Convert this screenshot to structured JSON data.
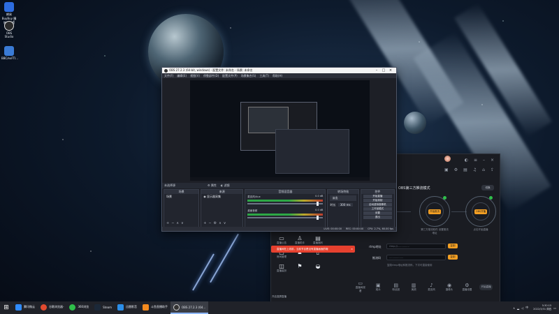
{
  "desktop": {
    "icons": [
      {
        "label": "網易BuyBuy\n購物與電商",
        "icon": "app-icon",
        "color": "#2d6cdf"
      },
      {
        "label": "OBS Studio",
        "icon": "obs-icon",
        "color": "#2b2b2b"
      },
      {
        "label": "BBC/exFTI...",
        "icon": "shortcut-icon",
        "color": "#3a7bd5"
      }
    ]
  },
  "obs": {
    "title": "OBS 27.2.3 (64-bit, windows) - 配置文件: 未命名 - 场景: 未命名",
    "menu": [
      "文件(F)",
      "编辑(E)",
      "视图(V)",
      "停靠部件(D)",
      "配置文件(P)",
      "场景集合(S)",
      "工具(T)",
      "帮助(H)"
    ],
    "controls": [
      "未选择源",
      "属性",
      "滤镜"
    ],
    "docks": {
      "scenes_title": "场景",
      "scenes": [
        "场景"
      ],
      "sources_title": "来源",
      "sources": [
        "显示器采集"
      ],
      "mixer_title": "音频混音器",
      "mixer": [
        {
          "label": "麦克风/Aux",
          "value": "0.0 dB"
        },
        {
          "label": "桌面音频",
          "value": "0.0 dB"
        }
      ],
      "transitions_title": "转场特效",
      "transition": "淡出",
      "duration_label": "时长",
      "duration": "300 ms",
      "controls_title": "控件",
      "control_buttons": [
        "开始直播",
        "开始录制",
        "启动虚拟摄像机",
        "工作室模式",
        "设置",
        "退出"
      ]
    },
    "status": [
      "LIVE: 00:00:00",
      "REC: 00:00:00",
      "CPU: 2.7%, 60.00 fps"
    ]
  },
  "companion": {
    "mode_title": "OBS第三方推流模式",
    "mode_switch": "切换",
    "steps": [
      {
        "tag": "开始推流",
        "caption": "第三方推流软件\n设置推流地址"
      },
      {
        "tag": "OBS开播",
        "caption": "点击开始直播"
      }
    ],
    "rtmp_label": "rtmp地址",
    "rtmp_value": "rtmp://...............",
    "key_label": "推流码",
    "key_value": "..................",
    "copy": "复制",
    "hint": "复制rtmp地址和推流码，下次可直接使用",
    "alert": "直播间在上线前，当前节目是没有直播画面的哦",
    "tools": [
      "直播公告",
      "直播助手",
      "直播福利",
      "房间管理",
      "",
      "",
      "直播装扮",
      "",
      ""
    ],
    "bottom": [
      "直播间观看",
      "观众",
      "粉丝团",
      "美颜",
      "麦克风",
      "摄像头",
      "直播设置"
    ],
    "start": "开始直播",
    "vertical_tag": "开启竖屏直播"
  },
  "taskbar": {
    "items": [
      {
        "label": "腾讯微云",
        "color": "#2f8bff"
      },
      {
        "label": "谷歌浏览器-",
        "color": "#e04a2f"
      },
      {
        "label": "360浏览",
        "color": "#2fbf4a"
      },
      {
        "label": "Steam",
        "color": "#1b2838"
      },
      {
        "label": "迅雷影音",
        "color": "#2b8ee8"
      },
      {
        "label": "斗鱼直播助手",
        "color": "#f48a1e"
      },
      {
        "label": "OBS 27.2.3 (64...",
        "color": "#333"
      }
    ],
    "time": "5:30:15",
    "date": "2022/3/31 周四"
  }
}
